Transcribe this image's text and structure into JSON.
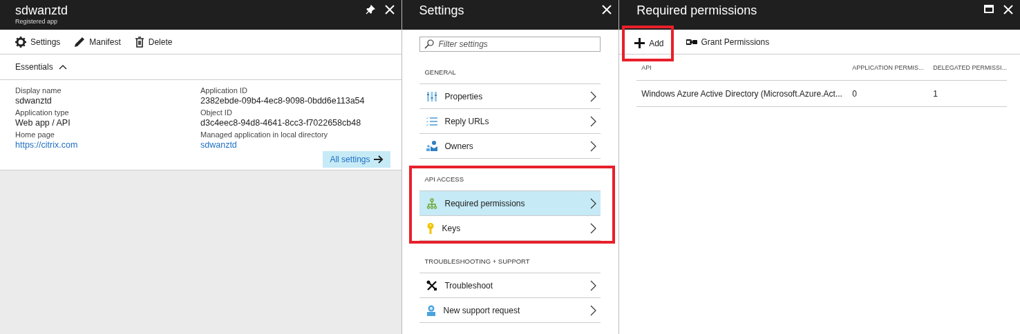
{
  "app_blade": {
    "title": "sdwanztd",
    "subtitle": "Registered app",
    "toolbar": [
      {
        "kind": "gear",
        "label": "Settings"
      },
      {
        "kind": "pencil",
        "label": "Manifest"
      },
      {
        "kind": "trash",
        "label": "Delete"
      }
    ],
    "essentials": {
      "label": "Essentials",
      "expanded": true
    },
    "fields": [
      {
        "label": "Display name",
        "value": "sdwanztd",
        "link": false
      },
      {
        "label": "Application ID",
        "value": "2382ebde-09b4-4ec8-9098-0bdd6e113a54",
        "link": false
      },
      {
        "label": "Application type",
        "value": "Web app / API",
        "link": false
      },
      {
        "label": "Object ID",
        "value": "d3c4eec8-94d8-4641-8cc3-f7022658cb48",
        "link": false
      },
      {
        "label": "Home page",
        "value": "https://citrix.com",
        "link": true
      },
      {
        "label": "Managed application in local directory",
        "value": "sdwanztd",
        "link": true
      }
    ],
    "all_settings": "All settings"
  },
  "settings_blade": {
    "title": "Settings",
    "filter": {
      "placeholder": "Filter settings"
    },
    "sections": [
      {
        "heading": "GENERAL",
        "highlighted": false,
        "items": [
          {
            "kind": "properties",
            "label": "Properties",
            "selected": false
          },
          {
            "kind": "reply",
            "label": "Reply URLs",
            "selected": false
          },
          {
            "kind": "owners",
            "label": "Owners",
            "selected": false
          }
        ]
      },
      {
        "heading": "API ACCESS",
        "highlighted": true,
        "items": [
          {
            "kind": "permissions",
            "label": "Required permissions",
            "selected": true
          },
          {
            "kind": "keys",
            "label": "Keys",
            "selected": false
          }
        ]
      },
      {
        "heading": "TROUBLESHOOTING + SUPPORT",
        "highlighted": false,
        "items": [
          {
            "kind": "troubleshoot",
            "label": "Troubleshoot",
            "selected": false
          },
          {
            "kind": "support",
            "label": "New support request",
            "selected": false
          }
        ]
      }
    ]
  },
  "permissions_blade": {
    "title": "Required permissions",
    "toolbar": [
      {
        "kind": "add",
        "label": "Add",
        "highlighted": true
      },
      {
        "kind": "grant",
        "label": "Grant Permissions",
        "highlighted": false
      }
    ],
    "table": {
      "columns": [
        "API",
        "APPLICATION PERMIS...",
        "DELEGATED PERMISSI..."
      ],
      "rows": [
        [
          "Windows Azure Active Directory (Microsoft.Azure.Act...",
          "0",
          "1"
        ]
      ]
    }
  }
}
